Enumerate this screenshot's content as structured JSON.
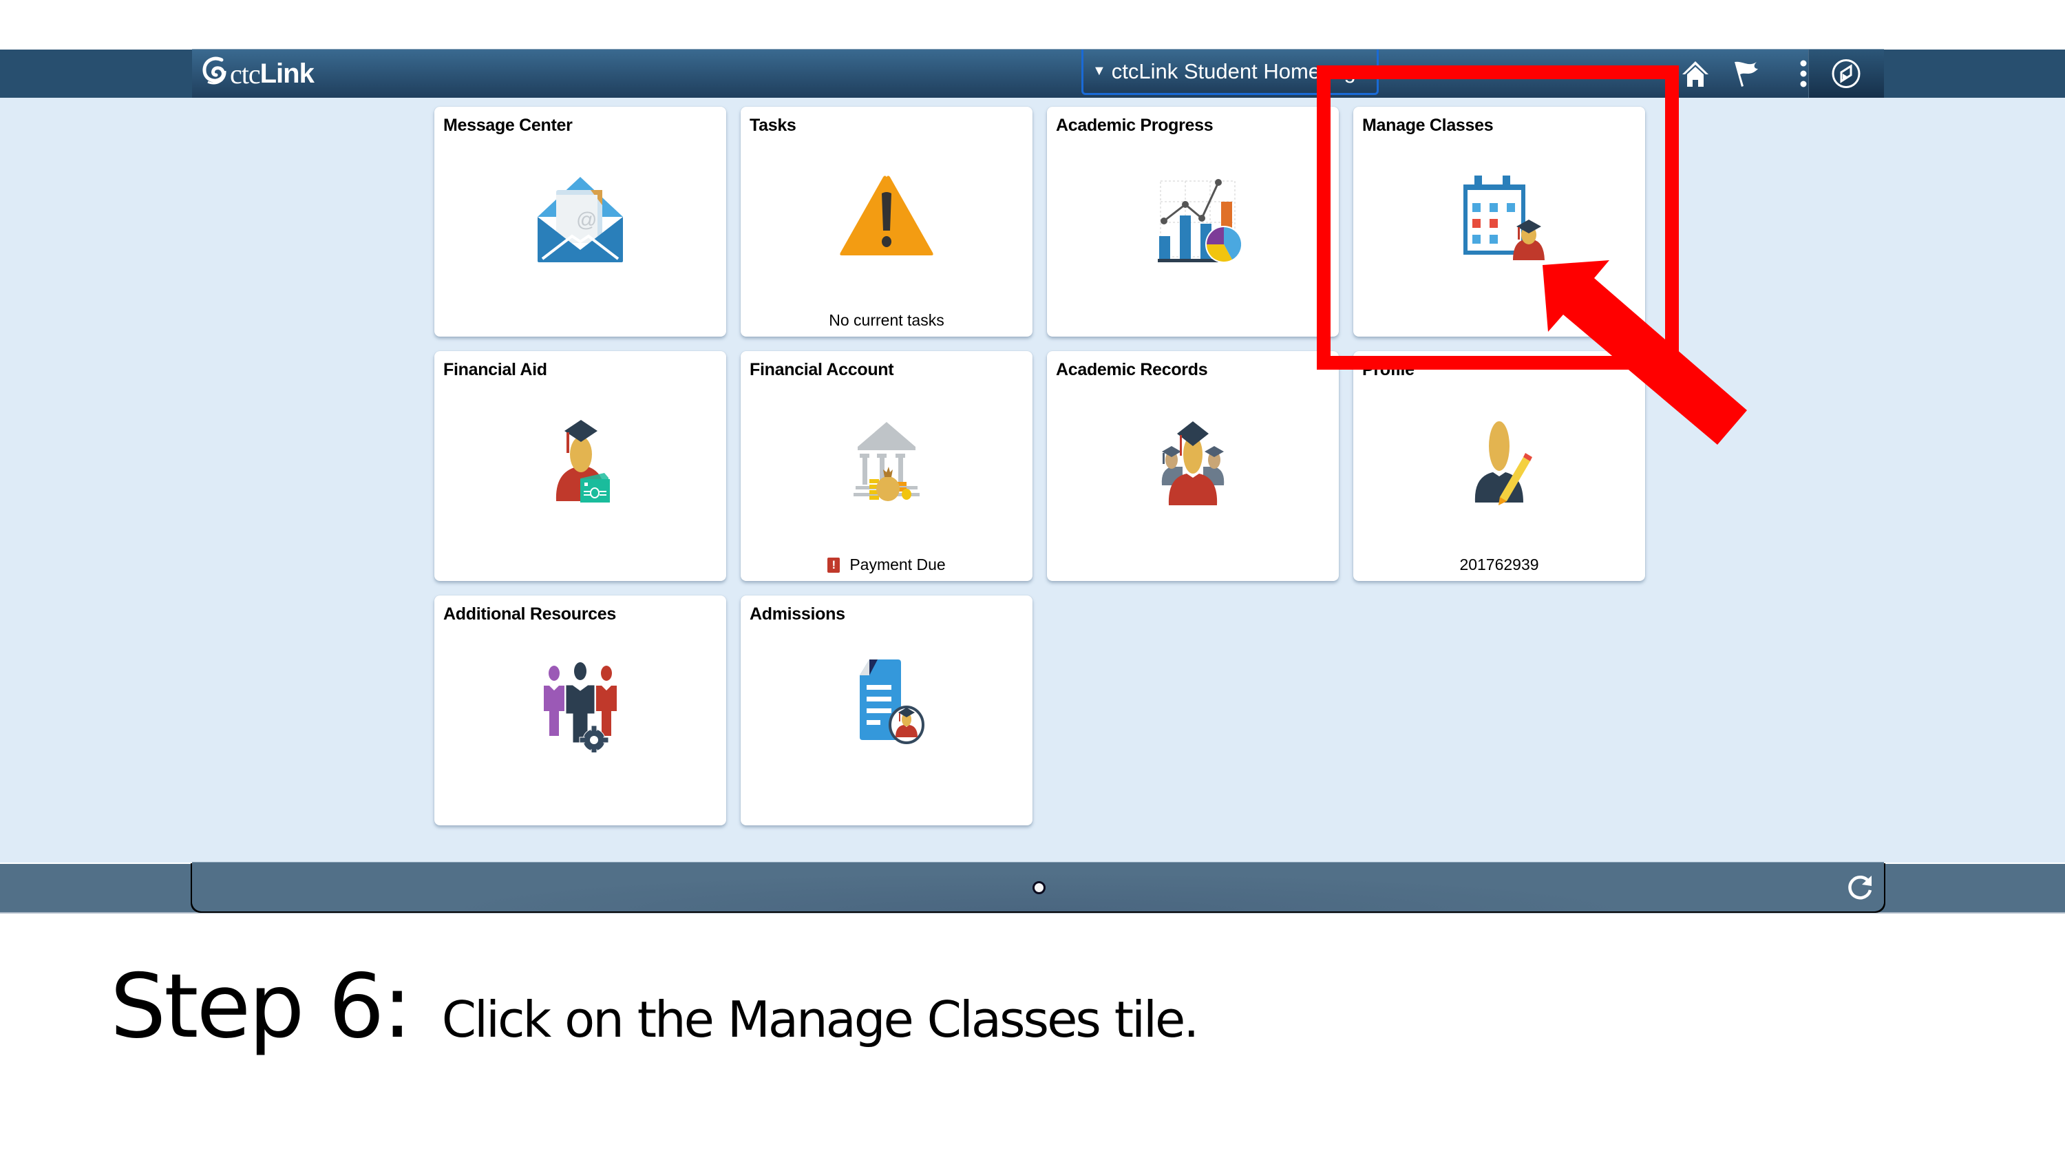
{
  "header": {
    "logo_text_prefix": "ctc",
    "logo_text_suffix": "Link",
    "page_title": "ctcLink Student Homepage",
    "icons": [
      "home-icon",
      "flag-icon",
      "more-options-icon",
      "navbar-compass-icon"
    ]
  },
  "tiles": [
    {
      "title": "Message Center",
      "icon": "envelope-icon",
      "footer": ""
    },
    {
      "title": "Tasks",
      "icon": "warning-icon",
      "footer": "No current tasks"
    },
    {
      "title": "Academic Progress",
      "icon": "charts-icon",
      "footer": ""
    },
    {
      "title": "Manage Classes",
      "icon": "calendar-student-icon",
      "footer": ""
    },
    {
      "title": "Financial Aid",
      "icon": "graduate-money-icon",
      "footer": ""
    },
    {
      "title": "Financial Account",
      "icon": "bank-money-icon",
      "footer": "Payment Due",
      "footer_alert": "!"
    },
    {
      "title": "Academic Records",
      "icon": "graduates-icon",
      "footer": ""
    },
    {
      "title": "Profile",
      "icon": "person-edit-icon",
      "footer": "201762939"
    },
    {
      "title": "Additional Resources",
      "icon": "people-gear-icon",
      "footer": ""
    },
    {
      "title": "Admissions",
      "icon": "document-student-icon",
      "footer": ""
    }
  ],
  "footer": {
    "page_indicator_count": 1,
    "page_indicator_active": 1,
    "refresh_icon": "refresh-icon"
  },
  "annotation": {
    "highlight_color": "#ff0000",
    "highlighted_tile": "Manage Classes"
  },
  "caption": {
    "step": "Step 6:",
    "text_before": "Click on the ",
    "text_emphasis": "Manage Classes",
    "text_after": " tile."
  },
  "colors": {
    "header_dark": "#284f6f",
    "content_bg": "#deebf7",
    "footer_bar": "#527088"
  }
}
